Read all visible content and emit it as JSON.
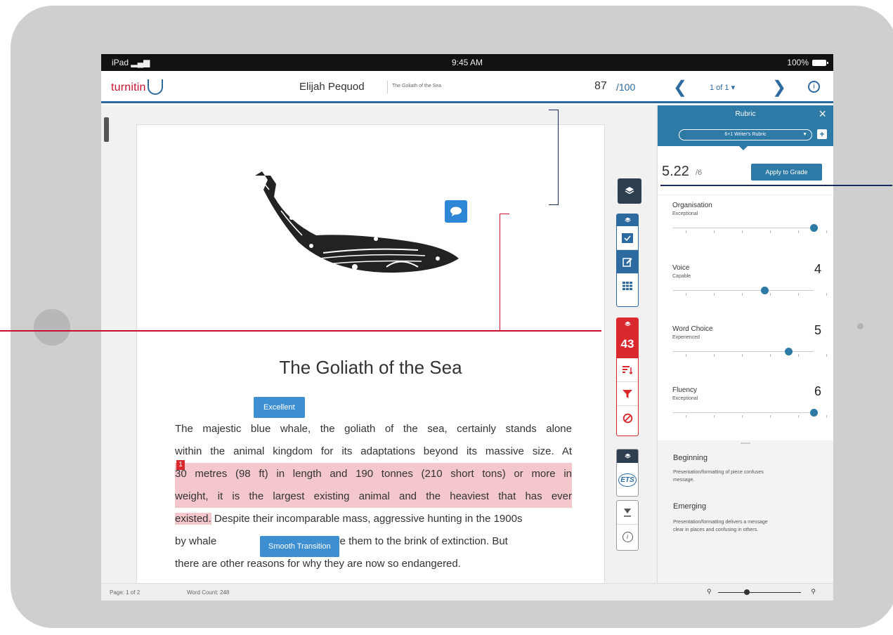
{
  "device": {
    "carrier": "iPad",
    "time": "9:45 AM",
    "battery": "100%"
  },
  "topbar": {
    "logo": "turnitin",
    "student_name": "Elijah Pequod",
    "assignment": "The Goliath of the Sea",
    "score": "87",
    "score_max": "/100",
    "page_selector": "1 of 1 ▾"
  },
  "document": {
    "title": "The Goliath of the Sea",
    "tags": {
      "excellent": "Excellent",
      "smooth": "Smooth Transition"
    },
    "match_number": "1",
    "lines": [
      "The majestic blue whale, the goliath of the sea, certainly stands alone",
      "within the animal kingdom for its adaptations beyond its massive size. At",
      "30 metres (98 ft) in length and 190 tonnes (210 short tons) or more in",
      "weight, it is the largest existing animal and the heaviest that has ever",
      "existed.",
      "Despite their incomparable mass, aggressive hunting in the 1900s",
      "by whale",
      "oil drove them to the brink of extinction. But",
      "there are other reasons for why they are now so endangered."
    ]
  },
  "toolbar": {
    "similarity_score": "43",
    "ets_label": "ETS"
  },
  "footer": {
    "page": "Page: 1 of 2",
    "word_count": "Word Count: 248"
  },
  "zoom": {
    "level": 0.35
  },
  "rubric": {
    "title": "Rubric",
    "selected": "6+1 Writer's Rubric",
    "total": "5.22",
    "total_max": "/6",
    "apply_label": "Apply to Grade",
    "criteria": [
      {
        "name": "Organisation",
        "level": "Exceptional",
        "value": "",
        "fraction": 1.0
      },
      {
        "name": "Voice",
        "level": "Capable",
        "value": "4",
        "fraction": 0.65
      },
      {
        "name": "Word Choice",
        "level": "Experienced",
        "value": "5",
        "fraction": 0.82
      },
      {
        "name": "Fluency",
        "level": "Exceptional",
        "value": "6",
        "fraction": 1.0
      }
    ],
    "descriptions": [
      {
        "title": "Beginning",
        "text": "Presentation/formatting of piece confuses message."
      },
      {
        "title": "Emerging",
        "text": "Presentation/formatting delivers a message clear in places and confusing in others."
      }
    ]
  },
  "colors": {
    "brand_red": "#c8102e",
    "brand_blue": "#2c6aa0",
    "accent": "#2e7aa6",
    "highlight": "#f3c7cc"
  }
}
